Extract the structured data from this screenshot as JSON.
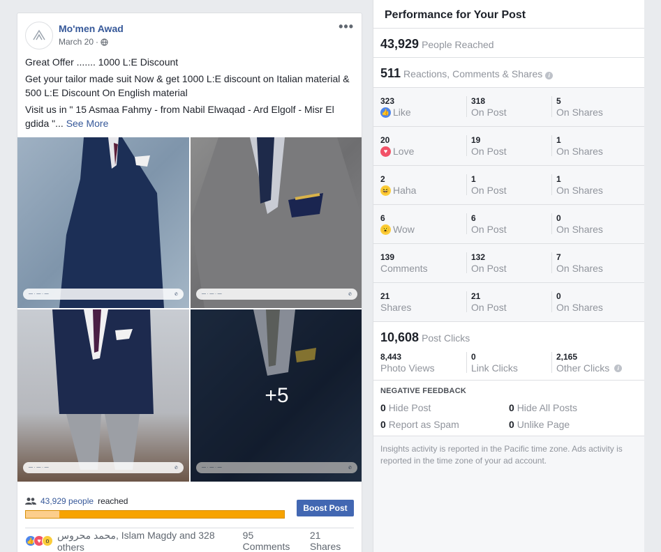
{
  "post": {
    "author": "Mo'men Awad",
    "date": "March 20",
    "date_separator": "·",
    "lines": [
      "Great Offer ....... 1000 L:E Discount",
      "Get your tailor made suit Now & get 1000 L:E discount on Italian material & 500 L:E Discount On English material",
      "Visit us in \" 15 Asmaa Fahmy - from Nabil Elwaqad - Ard Elgolf - Misr El gdida \"..."
    ],
    "see_more": "See More",
    "more_photos": "+5",
    "reach_count": "43,929 people",
    "reach_suffix": "reached",
    "reach_fill_percent": 13,
    "boost_label": "Boost Post",
    "reactors": "محمد محروس, Islam Magdy and 328 others",
    "comments": "95 Comments",
    "shares": "21 Shares"
  },
  "panel": {
    "title": "Performance for Your Post",
    "people_reached": "43,929",
    "people_reached_label": "People Reached",
    "engagement": "511",
    "engagement_label": "Reactions, Comments & Shares",
    "rows": [
      {
        "total": "323",
        "label": "Like",
        "icon": "like-icon",
        "on_post": "318",
        "on_post_label": "On Post",
        "on_shares": "5",
        "on_shares_label": "On Shares"
      },
      {
        "total": "20",
        "label": "Love",
        "icon": "love-icon",
        "on_post": "19",
        "on_post_label": "On Post",
        "on_shares": "1",
        "on_shares_label": "On Shares"
      },
      {
        "total": "2",
        "label": "Haha",
        "icon": "haha-icon",
        "on_post": "1",
        "on_post_label": "On Post",
        "on_shares": "1",
        "on_shares_label": "On Shares"
      },
      {
        "total": "6",
        "label": "Wow",
        "icon": "wow-icon",
        "on_post": "6",
        "on_post_label": "On Post",
        "on_shares": "0",
        "on_shares_label": "On Shares"
      },
      {
        "total": "139",
        "label": "Comments",
        "icon": "",
        "on_post": "132",
        "on_post_label": "On Post",
        "on_shares": "7",
        "on_shares_label": "On Shares"
      },
      {
        "total": "21",
        "label": "Shares",
        "icon": "",
        "on_post": "21",
        "on_post_label": "On Post",
        "on_shares": "0",
        "on_shares_label": "On Shares"
      }
    ],
    "post_clicks": "10,608",
    "post_clicks_label": "Post Clicks",
    "photo_views": "8,443",
    "photo_views_label": "Photo Views",
    "link_clicks": "0",
    "link_clicks_label": "Link Clicks",
    "other_clicks": "2,165",
    "other_clicks_label": "Other Clicks",
    "negative_title": "NEGATIVE FEEDBACK",
    "hide_post": "0",
    "hide_post_label": "Hide Post",
    "hide_all": "0",
    "hide_all_label": "Hide All Posts",
    "spam": "0",
    "spam_label": "Report as Spam",
    "unlike": "0",
    "unlike_label": "Unlike Page",
    "footnote": "Insights activity is reported in the Pacific time zone. Ads activity is reported in the time zone of your ad account."
  },
  "colors": {
    "link": "#365899",
    "boost": "#4267b2",
    "reach_bar": "#f7a300",
    "like": "#4e86ec",
    "love": "#f25268",
    "wow": "#fbcd3b"
  }
}
